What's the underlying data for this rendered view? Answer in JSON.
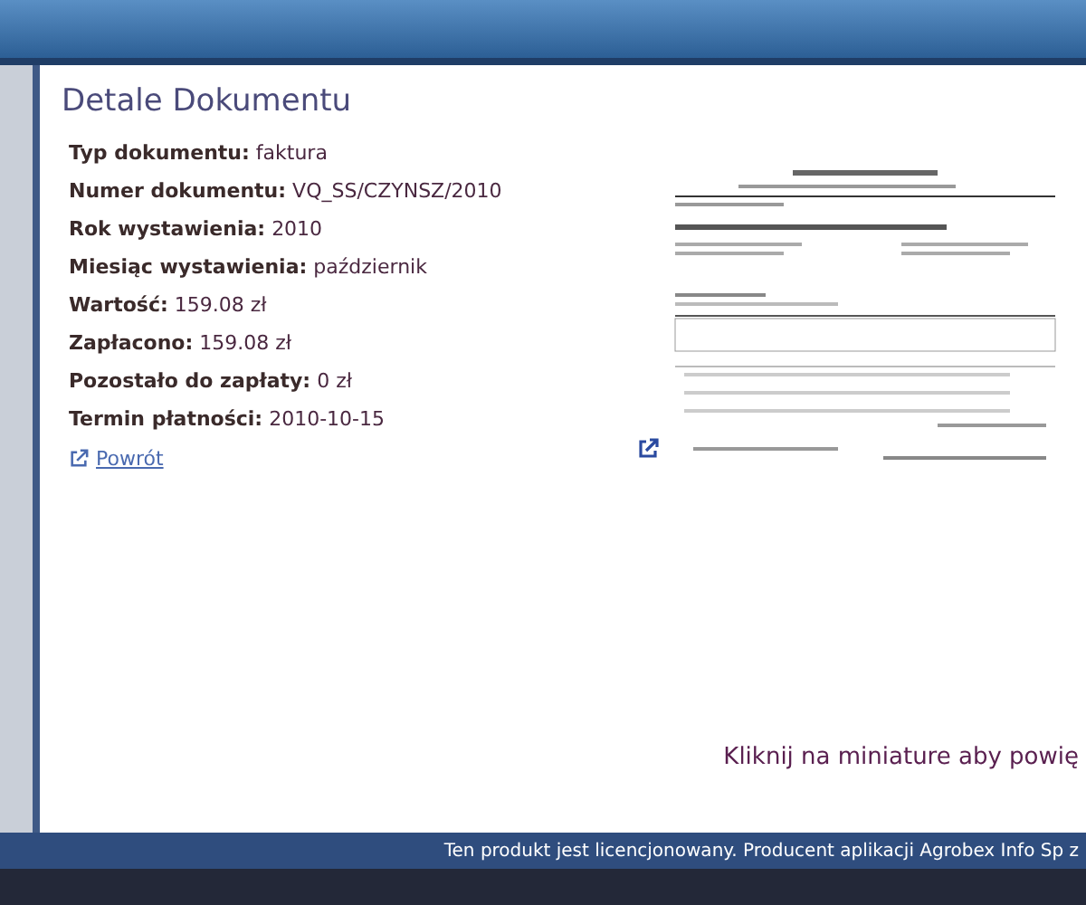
{
  "title": "Detale Dokumentu",
  "fields": [
    {
      "label": "Typ dokumentu:",
      "value": "faktura"
    },
    {
      "label": "Numer dokumentu:",
      "value": "VQ_SS/CZYNSZ/2010"
    },
    {
      "label": "Rok wystawienia:",
      "value": "2010"
    },
    {
      "label": "Miesiąc wystawienia:",
      "value": "październik"
    },
    {
      "label": "Wartość:",
      "value": "159.08 zł"
    },
    {
      "label": "Zapłacono:",
      "value": "159.08 zł"
    },
    {
      "label": "Pozostało do zapłaty:",
      "value": "0 zł"
    },
    {
      "label": "Termin płatności:",
      "value": "2010-10-15"
    }
  ],
  "back_link": "Powrót",
  "thumbnail_hint": "Kliknij na miniature aby powię",
  "footer": "Ten produkt jest licencjonowany. Producent aplikacji Agrobex Info Sp z"
}
